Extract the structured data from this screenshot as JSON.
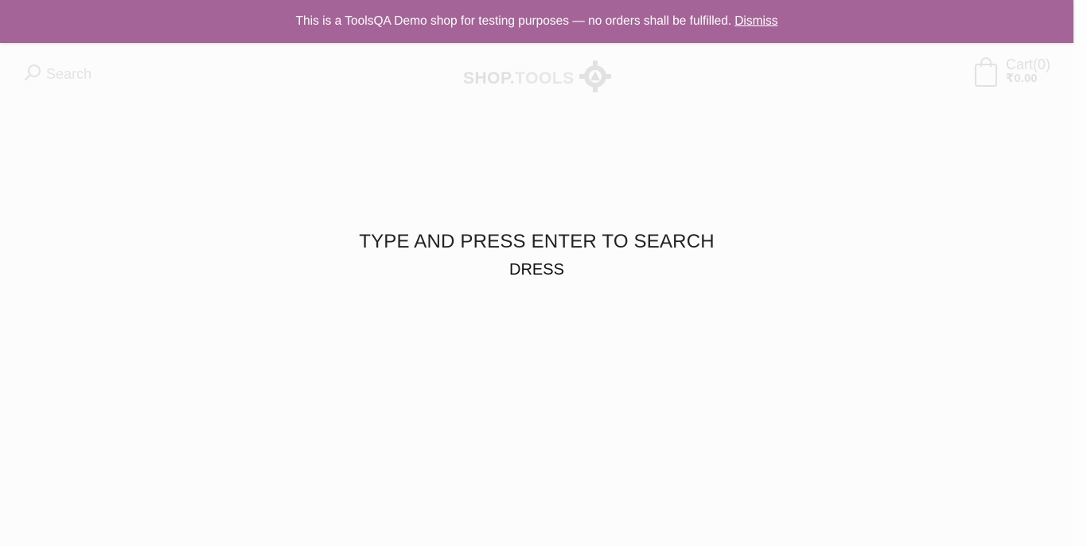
{
  "notice": {
    "text": "This is a ToolsQA Demo shop for testing purposes — no orders shall be fulfilled.",
    "dismiss_label": "Dismiss",
    "background": "#a46497"
  },
  "header": {
    "search_label": "Search",
    "logo": {
      "part1": "SHOP.",
      "part2": "TOOLS"
    },
    "cart": {
      "label": "Cart(0)",
      "total": "₹0.00"
    }
  },
  "search_overlay": {
    "prompt": "TYPE AND PRESS ENTER TO SEARCH",
    "query_value": "DRESS"
  }
}
